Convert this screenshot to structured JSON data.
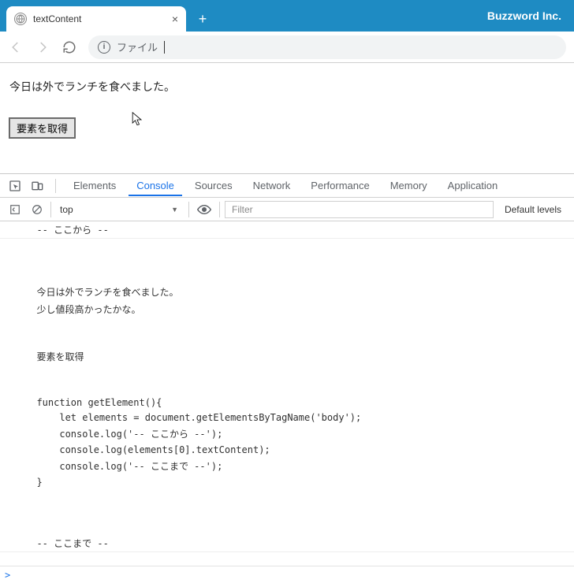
{
  "browser": {
    "brand": "Buzzword Inc.",
    "tab": {
      "title": "textContent",
      "close": "×",
      "new": "+"
    },
    "address": {
      "info_char": "i",
      "url_text": "ファイル"
    }
  },
  "page": {
    "paragraph": "今日は外でランチを食べました。",
    "button_label": "要素を取得"
  },
  "devtools": {
    "tabs": {
      "elements": "Elements",
      "console": "Console",
      "sources": "Sources",
      "network": "Network",
      "performance": "Performance",
      "memory": "Memory",
      "application": "Application"
    },
    "toolbar": {
      "context": "top",
      "filter_placeholder": "Filter",
      "levels": "Default levels"
    },
    "console_lines": [
      "  -- ここから --",
      "",
      "",
      "",
      "  今日は外でランチを食べました。",
      "  少し値段高かったかな。",
      "",
      "",
      "  要素を取得",
      "",
      "",
      "  function getElement(){",
      "      let elements = document.getElementsByTagName('body');",
      "      console.log('-- ここから --');",
      "      console.log(elements[0].textContent);",
      "      console.log('-- ここまで --');",
      "  }",
      "",
      "",
      "",
      "  -- ここまで --"
    ],
    "prompt": ">"
  }
}
